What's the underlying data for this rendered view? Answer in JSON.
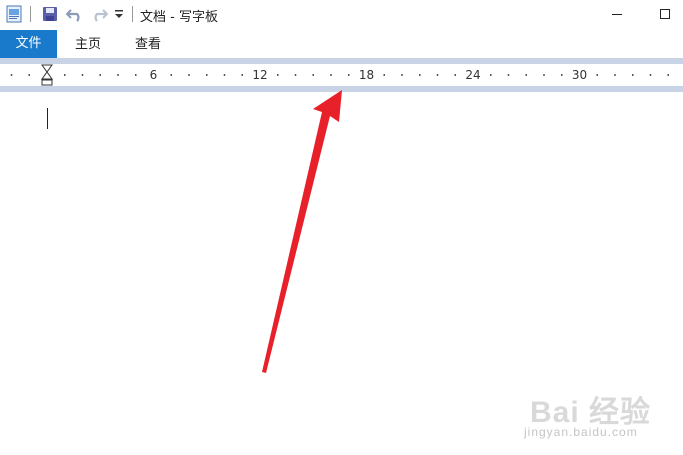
{
  "window": {
    "title": "文档 - 写字板",
    "quick_access": [
      "app-icon",
      "save-icon",
      "undo-icon",
      "redo-icon",
      "customize-dropdown-icon"
    ]
  },
  "ribbon": {
    "tabs": [
      {
        "label": "文件",
        "active": true
      },
      {
        "label": "主页",
        "active": false
      },
      {
        "label": "查看",
        "active": false
      }
    ]
  },
  "ruler": {
    "labels": [
      "6",
      "12",
      "18",
      "24",
      "30"
    ]
  },
  "watermark": {
    "text": "Bai 经验",
    "url": "jingyan.baidu.com"
  },
  "colors": {
    "file_tab": "#1979ca",
    "ruler_band": "#c8d3e6",
    "arrow": "#e8202a"
  }
}
